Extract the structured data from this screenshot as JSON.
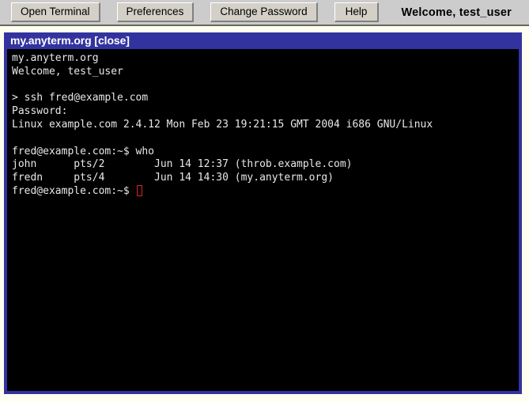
{
  "toolbar": {
    "buttons": [
      {
        "label": "Open Terminal",
        "name": "open-terminal-button"
      },
      {
        "label": "Preferences",
        "name": "preferences-button"
      },
      {
        "label": "Change Password",
        "name": "change-password-button"
      },
      {
        "label": "Help",
        "name": "help-button"
      }
    ],
    "welcome": "Welcome, test_user",
    "background_color": "#cccccc"
  },
  "page": {
    "background_color": "#fffff0"
  },
  "terminal": {
    "title_host": "my.anyterm.org",
    "close_label": "[close]",
    "titlebar_color": "#3333a0",
    "screen_background": "#000000",
    "text_color": "#e8e8e8",
    "cursor_color": "#dd2222",
    "lines": [
      "my.anyterm.org",
      "Welcome, test_user",
      "",
      "> ssh fred@example.com",
      "Password:",
      "Linux example.com 2.4.12 Mon Feb 23 19:21:15 GMT 2004 i686 GNU/Linux",
      "",
      "fred@example.com:~$ who",
      "john      pts/2        Jun 14 12:37 (throb.example.com)",
      "fredn     pts/4        Jun 14 14:30 (my.anyterm.org)"
    ],
    "prompt_line": "fred@example.com:~$ "
  }
}
